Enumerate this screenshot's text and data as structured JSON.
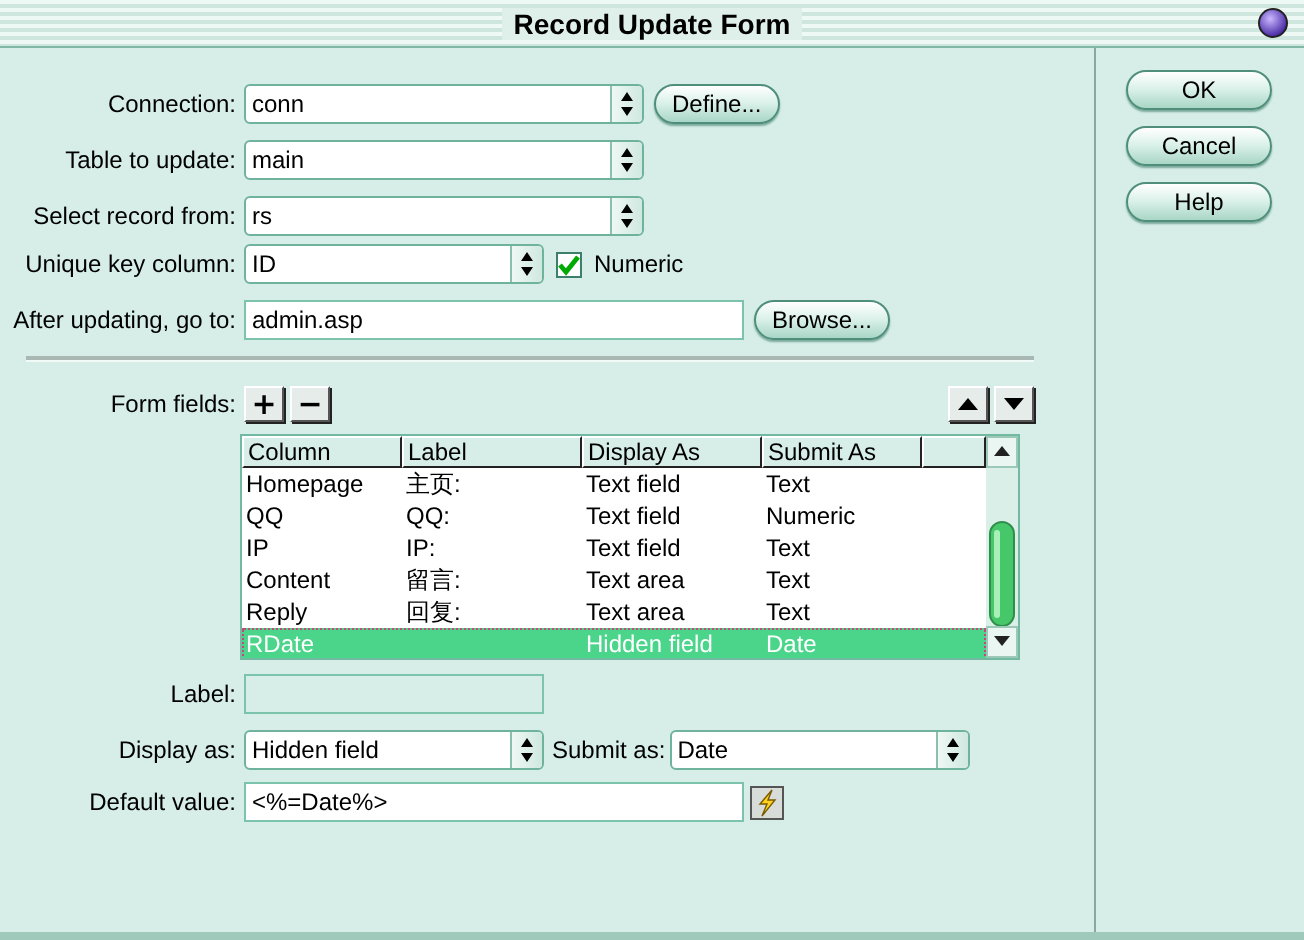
{
  "window": {
    "title": "Record Update Form"
  },
  "settings": [
    {
      "label": "Connection:",
      "kind": "select",
      "value": "conn",
      "button": "Define..."
    },
    {
      "label": "Table to update:",
      "kind": "select",
      "value": "main"
    },
    {
      "label": "Select record from:",
      "kind": "select",
      "value": "rs"
    },
    {
      "label": "Unique key column:",
      "kind": "select",
      "value": "ID",
      "checkbox": {
        "label": "Numeric",
        "checked": true
      }
    },
    {
      "label": "After updating, go to:",
      "kind": "text",
      "value": "admin.asp",
      "button": "Browse..."
    }
  ],
  "form_fields": {
    "label": "Form fields:",
    "add": "+",
    "remove": "−",
    "columns": [
      "Column",
      "Label",
      "Display As",
      "Submit As"
    ],
    "rows": [
      {
        "column": "Homepage",
        "label": "主页:",
        "display_as": "Text field",
        "submit_as": "Text",
        "selected": false
      },
      {
        "column": "QQ",
        "label": "QQ:",
        "display_as": "Text field",
        "submit_as": "Numeric",
        "selected": false
      },
      {
        "column": "IP",
        "label": "IP:",
        "display_as": "Text field",
        "submit_as": "Text",
        "selected": false
      },
      {
        "column": "Content",
        "label": "留言:",
        "display_as": "Text area",
        "submit_as": "Text",
        "selected": false
      },
      {
        "column": "Reply",
        "label": "回复:",
        "display_as": "Text area",
        "submit_as": "Text",
        "selected": false
      },
      {
        "column": "RDate",
        "display_as": "Hidden field",
        "submit_as": "Date",
        "selected": true
      }
    ]
  },
  "field_detail": {
    "label": {
      "label": "Label:",
      "disabled": true
    },
    "display_as": {
      "label": "Display as:",
      "value": "Hidden field"
    },
    "submit_as": {
      "label": "Submit as:",
      "value": "Date"
    },
    "default_value": {
      "label": "Default value:",
      "value": "<%=Date%>"
    }
  },
  "buttons": [
    "OK",
    "Cancel",
    "Help"
  ]
}
